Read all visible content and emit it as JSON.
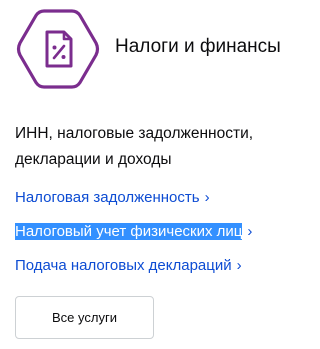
{
  "category": {
    "title": "Налоги и финансы",
    "icon": "tax-document-icon",
    "icon_color": "#7b2d8e",
    "description": "ИНН, налоговые задолженности, декларации и доходы"
  },
  "links": [
    {
      "label": "Налоговая задолженность",
      "chevron": "›"
    },
    {
      "label": "Налоговый учет физических лиц",
      "chevron": "›",
      "selected": true
    },
    {
      "label": "Подача налоговых деклараций",
      "chevron": "›"
    }
  ],
  "all_services_button": {
    "label": "Все услуги"
  },
  "colors": {
    "link": "#0d4cd3",
    "selection": "#3390ff",
    "text": "#0c0c0e",
    "button_border": "#cdd1d4"
  }
}
